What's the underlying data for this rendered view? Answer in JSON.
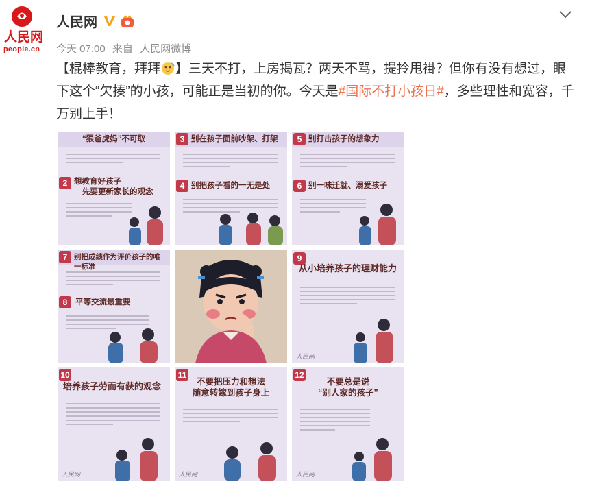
{
  "account": {
    "name": "人民网",
    "logo_text": "人民网",
    "logo_sub": "people.cn",
    "time": "今天 07:00",
    "source_prefix": "来自",
    "source": "人民网微博"
  },
  "post": {
    "p1": "【棍棒教育，拜拜",
    "p2": "】三天不打，上房揭瓦？两天不骂，提拎甩褂？但你有没有想过，眼下这个“欠揍”的小孩，可能正是当初的你。今天是",
    "hashtag": "#国际不打小孩日#",
    "p3": "，多些理性和宽容，千万别上手！"
  },
  "images": [
    {
      "title": "“狠爸虎妈”不可取",
      "num": "",
      "title2": "想教育好孩子",
      "title3": "先要更新家长的观念",
      "num2": "2"
    },
    {
      "title": "别在孩子面前吵架、打架",
      "num": "3",
      "title2": "别把孩子看的一无是处",
      "title3": "",
      "num2": "4"
    },
    {
      "title": "别打击孩子的想象力",
      "num": "5",
      "title2": "别一味迁就、溺爱孩子",
      "title3": "",
      "num2": "6"
    },
    {
      "title": "别把成绩作为评价孩子的唯一标准",
      "num": "7",
      "title2": "平等交流最重要",
      "title3": "",
      "num2": "8"
    },
    {
      "title": "",
      "num": "",
      "title2": "",
      "title3": "",
      "num2": ""
    },
    {
      "title": "从小培养孩子的理财能力",
      "num": "9",
      "title2": "",
      "title3": "",
      "num2": ""
    },
    {
      "title": "培养孩子劳而有获的观念",
      "num": "10",
      "title2": "",
      "title3": "",
      "num2": ""
    },
    {
      "title": "不要把压力和想法",
      "num": "11",
      "title2": "随意转嫁到孩子身上",
      "title3": "",
      "num2": ""
    },
    {
      "title": "不要总是说",
      "num": "12",
      "title2": "“别人家的孩子”",
      "title3": "",
      "num2": ""
    }
  ],
  "watermark": "人民网"
}
